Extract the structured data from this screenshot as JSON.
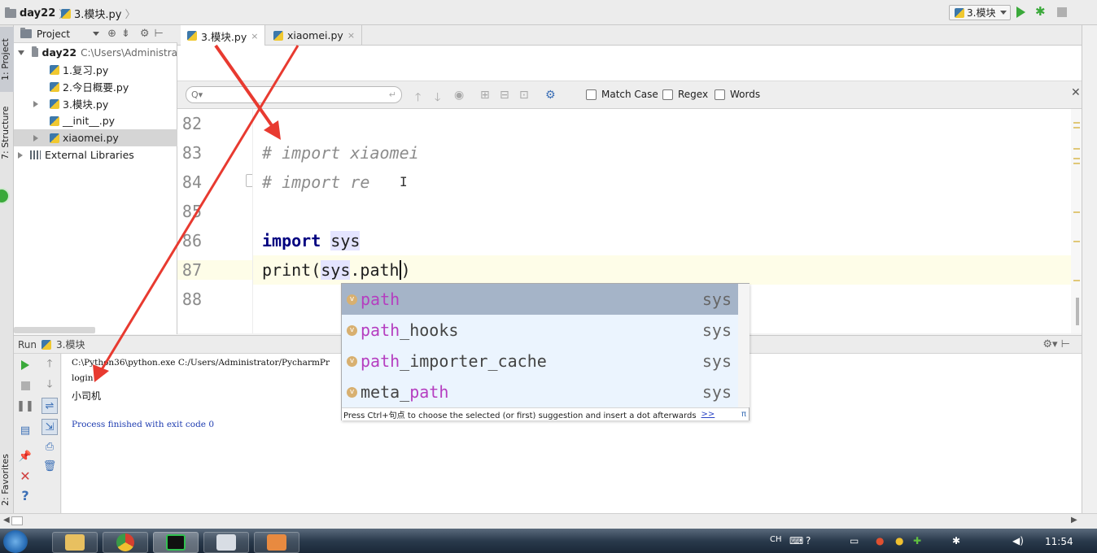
{
  "breadcrumb": {
    "project": "day22",
    "file": "3.模块.py"
  },
  "run_config": {
    "label": "3.模块"
  },
  "left_strip": {
    "project_tab": "1: Project",
    "structure_tab": "7: Structure",
    "favorites_tab": "2: Favorites"
  },
  "project_panel": {
    "title": "Project",
    "root": {
      "name": "day22",
      "path": "C:\\Users\\Administra"
    },
    "items": [
      {
        "label": "1.复习.py"
      },
      {
        "label": "2.今日概要.py"
      },
      {
        "label": "3.模块.py"
      },
      {
        "label": "__init__.py"
      },
      {
        "label": "xiaomei.py"
      }
    ],
    "libraries": "External Libraries"
  },
  "tabs": [
    {
      "label": "3.模块.py",
      "close": "×"
    },
    {
      "label": "xiaomei.py",
      "close": "×"
    }
  ],
  "findbar": {
    "placeholder": "Q▾",
    "match_case": "Match Case",
    "regex": "Regex",
    "words": "Words"
  },
  "editor": {
    "lines": [
      {
        "no": "82",
        "text": ""
      },
      {
        "no": "83",
        "text": "# import xiaomei"
      },
      {
        "no": "84",
        "text": "# import re"
      },
      {
        "no": "85",
        "text": ""
      },
      {
        "no": "86",
        "kw": "import",
        "mod": "sys"
      },
      {
        "no": "87",
        "fn": "print(",
        "obj": "sys",
        "attr": ".path",
        "close": ")"
      },
      {
        "no": "88",
        "text": ""
      }
    ]
  },
  "autocomplete": {
    "items": [
      {
        "match": "path",
        "rest": "",
        "source": "sys"
      },
      {
        "match": "path",
        "rest": "_hooks",
        "source": "sys"
      },
      {
        "match": "path",
        "rest": "_importer_cache",
        "source": "sys"
      },
      {
        "match": "meta_",
        "rest": "",
        "match2": "path",
        "source": "sys"
      }
    ],
    "badge": "v",
    "hint": "Press Ctrl+句点 to choose the selected (or first) suggestion and insert a dot afterwards",
    "hint_link": ">>",
    "pi": "π"
  },
  "run_panel": {
    "title": "Run",
    "config": "3.模块",
    "console": [
      "C:\\Python36\\python.exe C:/Users/Administrator/PycharmPr",
      "login",
      "小司机",
      "",
      "Process finished with exit code 0"
    ]
  },
  "taskbar": {
    "time": "11:54",
    "ime": "CH"
  }
}
